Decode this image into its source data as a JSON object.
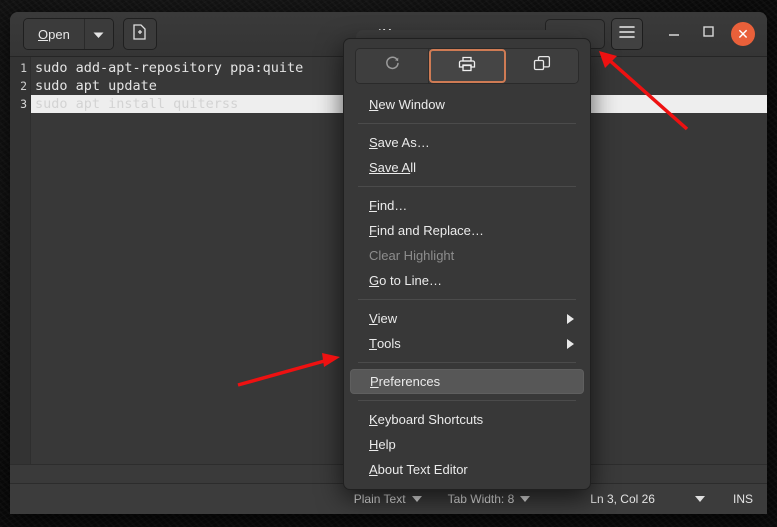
{
  "window": {
    "title": "*Un",
    "title_full_visible": "*Un"
  },
  "toolbar": {
    "open_label_pre": "O",
    "open_label_rest": "pen",
    "open_mnemonic": "O",
    "open_dropdown_icon": "chevron-down-icon",
    "new_document_icon": "new-document-icon"
  },
  "header_right": {
    "menu_icon": "hamburger-menu-icon",
    "minimize_icon": "minimize-icon",
    "maximize_icon": "maximize-icon",
    "close_icon": "close-icon",
    "close_glyph": "✕"
  },
  "editor": {
    "lines": [
      {
        "num": "1",
        "text": "sudo add-apt-repository ppa:quite",
        "selected": false
      },
      {
        "num": "2",
        "text": "sudo apt update",
        "selected": false
      },
      {
        "num": "3",
        "text": "sudo apt install quiterss",
        "selected": true
      }
    ]
  },
  "statusbar": {
    "language": "Plain Text",
    "tab_width": "Tab Width: 8",
    "position": "Ln 3, Col 26",
    "insert_mode": "INS"
  },
  "popup": {
    "icon_buttons": [
      {
        "name": "reload-icon",
        "state": "dim",
        "label": "Reload"
      },
      {
        "name": "print-icon",
        "state": "selected",
        "label": "Print"
      },
      {
        "name": "new-window-icon",
        "state": "normal",
        "label": "New Window"
      }
    ],
    "items": [
      {
        "pre": "N",
        "post": "ew Window",
        "type": "item",
        "state": "normal"
      },
      {
        "type": "separator"
      },
      {
        "pre": "S",
        "post": "ave As…",
        "type": "item",
        "state": "normal"
      },
      {
        "pre": "Save A",
        "post": "ll",
        "mnemonic_at_end": true,
        "type": "item",
        "state": "normal"
      },
      {
        "type": "separator"
      },
      {
        "pre": "F",
        "post": "ind…",
        "type": "item",
        "state": "normal"
      },
      {
        "pre": "F",
        "post": "ind and Replace…",
        "type": "item",
        "state": "normal"
      },
      {
        "pre": "",
        "post": "Clear Highlight",
        "type": "item",
        "state": "disabled"
      },
      {
        "pre": "G",
        "post": "o to Line…",
        "type": "item",
        "state": "normal",
        "mnemonic_second": true
      },
      {
        "type": "separator"
      },
      {
        "pre": "V",
        "post": "iew",
        "type": "submenu",
        "state": "normal"
      },
      {
        "pre": "T",
        "post": "ools",
        "type": "submenu",
        "state": "normal"
      },
      {
        "type": "separator"
      },
      {
        "pre": "P",
        "post": "references",
        "type": "item",
        "state": "hover"
      },
      {
        "type": "separator"
      },
      {
        "pre": "K",
        "post": "eyboard Shortcuts",
        "type": "item",
        "state": "normal"
      },
      {
        "pre": "H",
        "post": "elp",
        "type": "item",
        "state": "normal"
      },
      {
        "pre": "A",
        "post": "bout Text Editor",
        "type": "item",
        "state": "normal"
      }
    ]
  },
  "annotations": {
    "arrow_color": "#ee1111",
    "arrow_to_menu_button": "points to hamburger-menu-icon",
    "arrow_to_preferences": "points to Preferences menu item"
  },
  "colors": {
    "accent_close": "#e9603a",
    "accent_selected_icon_border": "#cf7b54",
    "window_bg": "#323232",
    "editor_bg": "#383838",
    "popup_bg": "#383838",
    "selection_bg": "#eeeeee"
  }
}
